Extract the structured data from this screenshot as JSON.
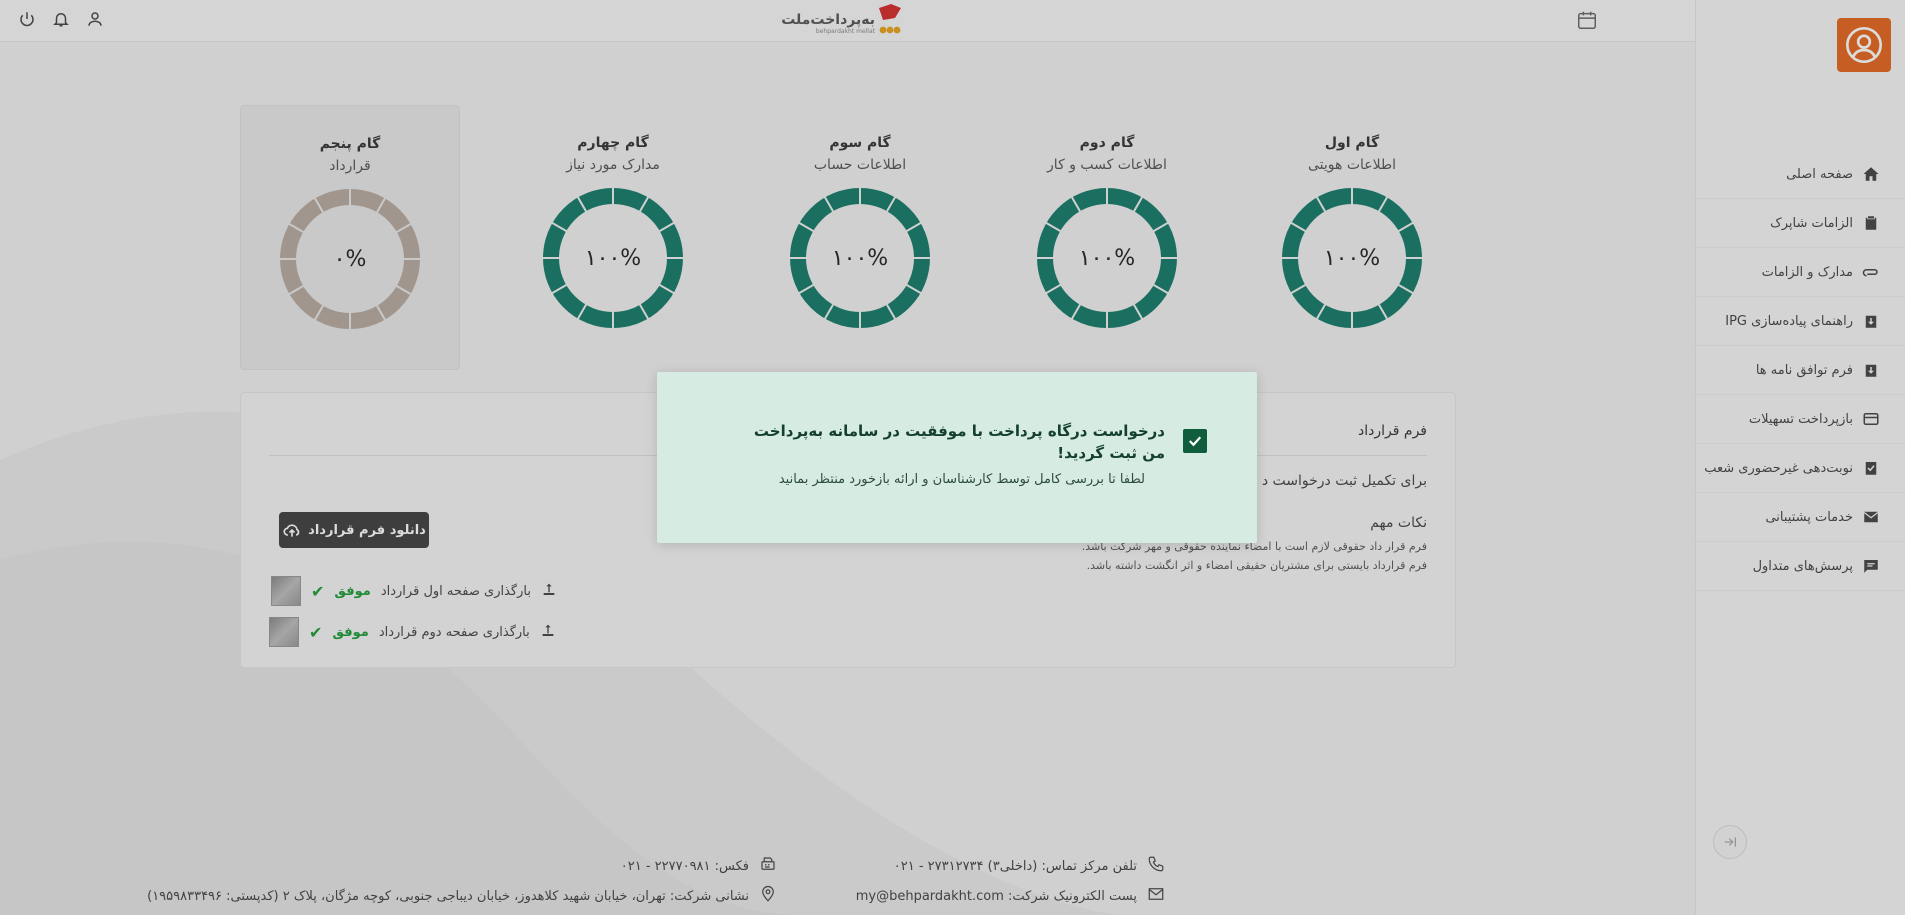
{
  "brand": {
    "name": "به‌پرداخت‌ملت",
    "latin": "behpardakht mellat"
  },
  "sidebar": {
    "items": [
      {
        "label": "صفحه اصلی",
        "icon": "home-icon"
      },
      {
        "label": "الزامات شاپرک",
        "icon": "clipboard-icon"
      },
      {
        "label": "مدارک و الزامات",
        "icon": "paperclip-icon"
      },
      {
        "label": "راهنمای پیاده‌سازی IPG",
        "icon": "download-box-icon"
      },
      {
        "label": "فرم توافق نامه ها",
        "icon": "download-box-icon"
      },
      {
        "label": "بازپرداخت تسهیلات",
        "icon": "credit-card-icon"
      },
      {
        "label": "نوبت‌دهی غیرحضوری شعب",
        "icon": "check-clipboard-icon"
      },
      {
        "label": "خدمات پشتیبانی",
        "icon": "mail-icon"
      },
      {
        "label": "پرسش‌های متداول",
        "icon": "chat-icon"
      }
    ]
  },
  "steps": [
    {
      "title": "گام اول",
      "subtitle": "اطلاعات هویتی",
      "percent_label": "۱۰۰%",
      "percent": 100
    },
    {
      "title": "گام دوم",
      "subtitle": "اطلاعات کسب و کار",
      "percent_label": "۱۰۰%",
      "percent": 100
    },
    {
      "title": "گام سوم",
      "subtitle": "اطلاعات حساب",
      "percent_label": "۱۰۰%",
      "percent": 100
    },
    {
      "title": "گام چهارم",
      "subtitle": "مدارک مورد نیاز",
      "percent_label": "۱۰۰%",
      "percent": 100
    },
    {
      "title": "گام پنجم",
      "subtitle": "قرارداد",
      "percent_label": "۰%",
      "percent": 0
    }
  ],
  "colors": {
    "complete": "#137a68",
    "pending": "#b8aaa0",
    "accent": "#e4641e",
    "success": "#1a9b35"
  },
  "contract": {
    "title": "فرم قرارداد",
    "intro": "برای تکمیل ثبت درخواست د",
    "notes_title": "نکات مهم",
    "notes": [
      "فرم قرار داد حقوقی لازم است با امضاء نماینده حقوقی و مهر شرکت باشد.",
      "فرم قرارداد بایستی برای مشتریان حقیقی امضاء و اثر انگشت داشته باشد."
    ],
    "download_label": "دانلود فرم قرارداد",
    "uploads": [
      {
        "label": "بارگذاری صفحه اول قرارداد",
        "status": "موفق"
      },
      {
        "label": "بارگذاری صفحه دوم قرارداد",
        "status": "موفق"
      }
    ]
  },
  "modal": {
    "title": "درخواست درگاه پرداخت با موفقیت در سامانه به‌پرداخت من ثبت گردید!",
    "body": "لطفا تا بررسی کامل توسط کارشناسان و ارائه بازخورد منتظر بمانید"
  },
  "footer": {
    "phone": "تلفن مرکز تماس: (داخلی۳) ۲۷۳۱۲۷۳۴ - ۰۲۱",
    "fax": "فکس: ۲۲۷۷۰۹۸۱ - ۰۲۱",
    "email": "پست الکترونیک شرکت: my@behpardakht.com",
    "address": "نشانی شرکت: تهران، خیابان شهید کلاهدوز، خیابان دیباجی جنوبی، کوچه مژگان، پلاک ۲ (کدپستی: ۱۹۵۹۸۳۳۴۹۶)"
  }
}
